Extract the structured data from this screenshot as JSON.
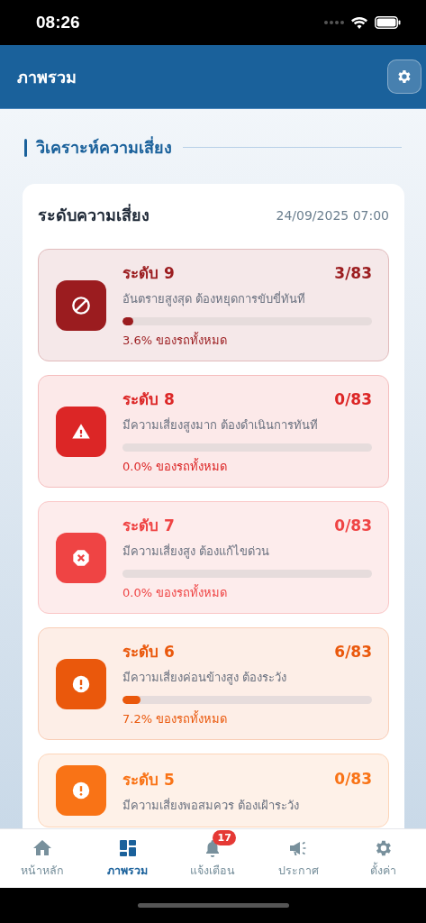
{
  "status_bar": {
    "time": "08:26"
  },
  "header": {
    "title": "ภาพรวม"
  },
  "section": {
    "title": "วิเคราะห์ความเสี่ยง"
  },
  "risk_panel": {
    "title": "ระดับความเสี่ยง",
    "timestamp": "24/09/2025 07:00",
    "levels": [
      {
        "kind": "ban",
        "title": "ระดับ 9",
        "count": "3/83",
        "description": "อันตรายสูงสุด ต้องหยุดการขับขี่ทันที",
        "level": 0.036,
        "percent": "3.6% ของรถทั้งหมด",
        "color": "#9b1c1f"
      },
      {
        "kind": "warning",
        "title": "ระดับ 8",
        "count": "0/83",
        "description": "มีความเสี่ยงสูงมาก ต้องดำเนินการทันที",
        "level": 0,
        "percent": "0.0% ของรถทั้งหมด",
        "color": "#dc2626"
      },
      {
        "kind": "stop",
        "title": "ระดับ 7",
        "count": "0/83",
        "description": "มีความเสี่ยงสูง ต้องแก้ไขด่วน",
        "level": 0,
        "percent": "0.0% ของรถทั้งหมด",
        "color": "#ef4444"
      },
      {
        "kind": "alert",
        "title": "ระดับ 6",
        "count": "6/83",
        "description": "มีความเสี่ยงค่อนข้างสูง ต้องระวัง",
        "level": 0.072,
        "percent": "7.2% ของรถทั้งหมด",
        "color": "#ea580c"
      },
      {
        "kind": "alert",
        "title": "ระดับ 5",
        "count": "0/83",
        "description": "มีความเสี่ยงพอสมควร ต้องเฝ้าระวัง",
        "color": "#f97316"
      }
    ]
  },
  "tab_bar": [
    {
      "kind": "home",
      "label": "หน้าหลัก",
      "selected": false
    },
    {
      "kind": "dashboard",
      "label": "ภาพรวม",
      "selected": true
    },
    {
      "kind": "bell",
      "label": "แจ้งเตือน",
      "selected": false,
      "badge": "17"
    },
    {
      "kind": "megaphone",
      "label": "ประกาศ",
      "selected": false
    },
    {
      "kind": "gear",
      "label": "ตั้งค่า",
      "selected": false
    }
  ]
}
